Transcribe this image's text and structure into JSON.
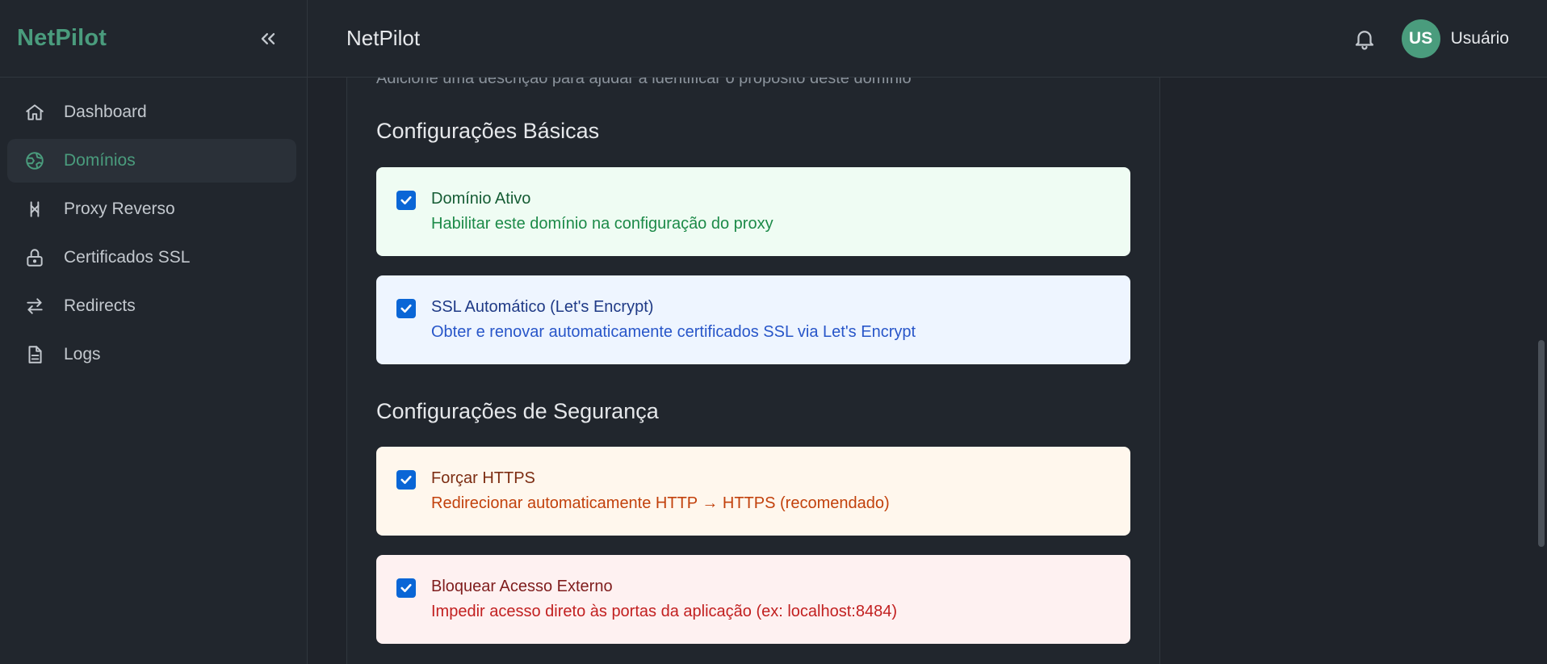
{
  "sidebar": {
    "brand": "NetPilot",
    "items": [
      {
        "label": "Dashboard",
        "icon": "home-icon",
        "active": false
      },
      {
        "label": "Domínios",
        "icon": "globe-icon",
        "active": true
      },
      {
        "label": "Proxy Reverso",
        "icon": "proxy-icon",
        "active": false
      },
      {
        "label": "Certificados SSL",
        "icon": "lock-icon",
        "active": false
      },
      {
        "label": "Redirects",
        "icon": "arrows-icon",
        "active": false
      },
      {
        "label": "Logs",
        "icon": "file-icon",
        "active": false
      }
    ]
  },
  "topbar": {
    "title": "NetPilot",
    "user_initials": "US",
    "user_name": "Usuário"
  },
  "form": {
    "description_hint": "Adicione uma descrição para ajudar a identificar o propósito deste domínio",
    "basic_title": "Configurações Básicas",
    "security_title": "Configurações de Segurança",
    "options": [
      {
        "title": "Domínio Ativo",
        "sub": "Habilitar este domínio na configuração do proxy",
        "checked": true
      },
      {
        "title": "SSL Automático (Let's Encrypt)",
        "sub": "Obter e renovar automaticamente certificados SSL via Let's Encrypt",
        "checked": true
      },
      {
        "title": "Forçar HTTPS",
        "sub": "Redirecionar automaticamente HTTP → HTTPS (recomendado)",
        "checked": true
      },
      {
        "title": "Bloquear Acesso Externo",
        "sub": "Impedir acesso direto às portas da aplicação (ex: localhost:8484)",
        "checked": true
      }
    ]
  },
  "colors": {
    "accent": "#4a9c7d",
    "checkbox": "#0a66d6"
  }
}
